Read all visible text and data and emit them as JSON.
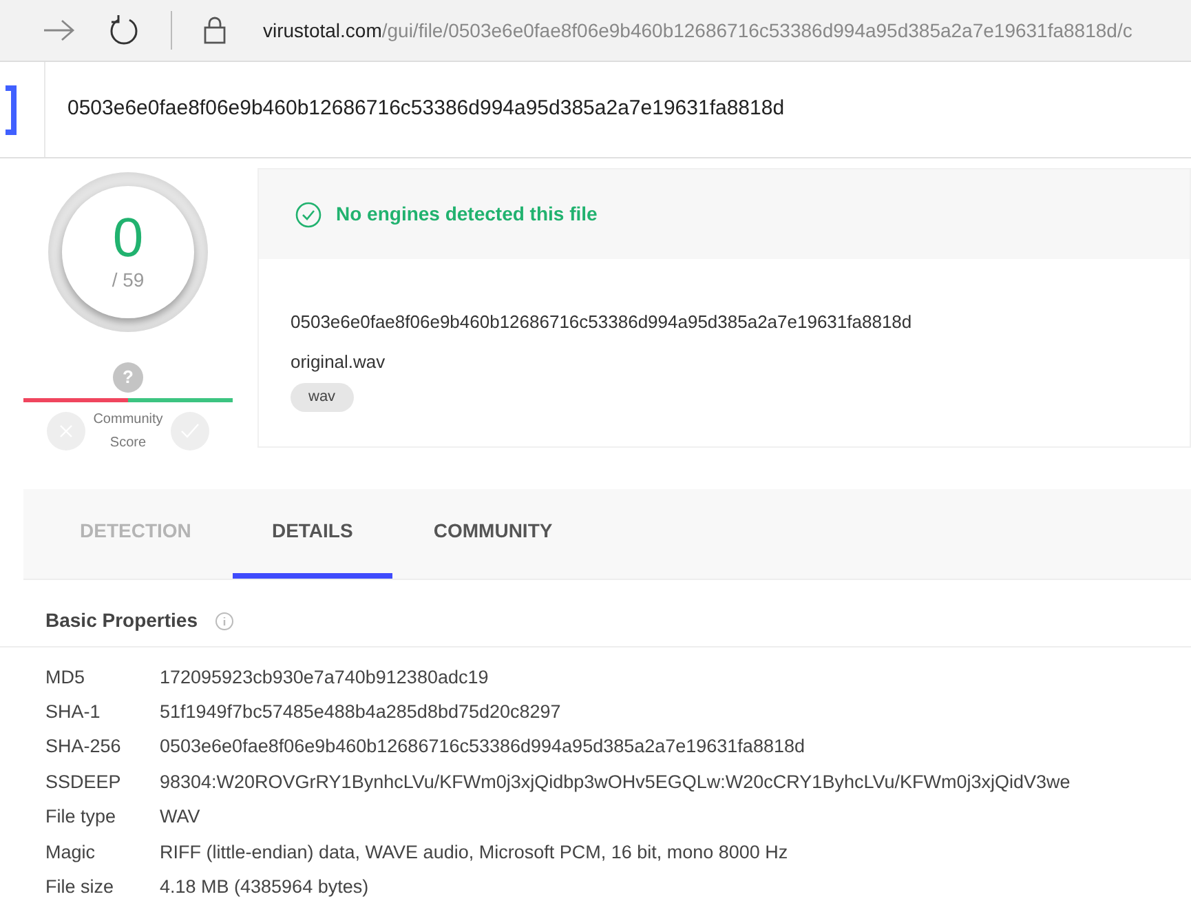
{
  "browser": {
    "url_host": "virustotal.com",
    "url_path": "/gui/file/0503e6e0fae8f06e9b460b12686716c53386d994a95d385a2a7e19631fa8818d/c"
  },
  "search": {
    "value": "0503e6e0fae8f06e9b460b12686716c53386d994a95d385a2a7e19631fa8818d"
  },
  "score": {
    "detections": "0",
    "total": "/ 59",
    "community_label": "Community",
    "community_label_2": "Score",
    "community_marker": "?"
  },
  "summary": {
    "status": "No engines detected this file",
    "hash": "0503e6e0fae8f06e9b460b12686716c53386d994a95d385a2a7e19631fa8818d",
    "filename": "original.wav",
    "tags": [
      "wav"
    ]
  },
  "tabs": [
    {
      "label": "DETECTION",
      "selected": false,
      "disabled": true
    },
    {
      "label": "DETAILS",
      "selected": true,
      "disabled": false
    },
    {
      "label": "COMMUNITY",
      "selected": false,
      "disabled": false
    }
  ],
  "basic_properties": {
    "title": "Basic Properties",
    "rows": [
      {
        "label": "MD5",
        "value": "172095923cb930e7a740b912380adc19"
      },
      {
        "label": "SHA-1",
        "value": "51f1949f7bc57485e488b4a285d8bd75d20c8297"
      },
      {
        "label": "SHA-256",
        "value": "0503e6e0fae8f06e9b460b12686716c53386d994a95d385a2a7e19631fa8818d"
      },
      {
        "label": "SSDEEP",
        "value": "98304:W20ROVGrRY1BynhcLVu/KFWm0j3xjQidbp3wOHv5EGQLw:W20cCRY1ByhcLVu/KFWm0j3xjQidV3we"
      },
      {
        "label": "File type",
        "value": "WAV"
      },
      {
        "label": "Magic",
        "value": "RIFF (little-endian) data, WAVE audio, Microsoft PCM, 16 bit, mono 8000 Hz"
      },
      {
        "label": "File size",
        "value": "4.18 MB (4385964 bytes)"
      }
    ]
  }
}
